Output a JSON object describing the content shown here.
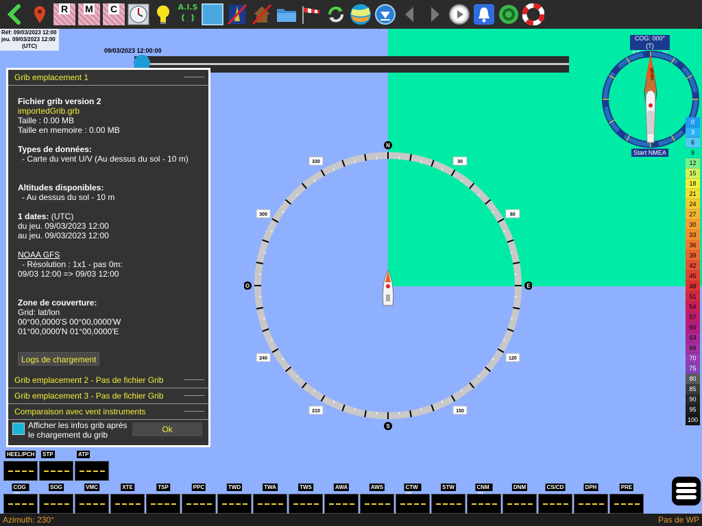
{
  "toolbar": {
    "items": [
      "back-arrow-icon",
      "map-pin-icon",
      "R",
      "M",
      "C",
      "clock-icon",
      "bulb-icon",
      "A.I.S",
      "square-icon",
      "boat-cross-icon",
      "home-cross-icon",
      "folder-icon",
      "windsock-icon",
      "refresh-icon",
      "grib-icon",
      "download-icon",
      "prev-icon",
      "next-icon",
      "play-icon",
      "bell-icon",
      "target-icon",
      "lifebuoy-icon"
    ],
    "ais_label": "A.I.S"
  },
  "ref": {
    "line1": "Réf: 09/03/2023 12:00",
    "line2": "jeu. 09/03/2023 12:00",
    "line3": "(UTC)"
  },
  "time_slider": {
    "label": "09/03/2023 12:00:00",
    "position": 0
  },
  "grib": {
    "section1": "Grib emplacement 1",
    "file_title": "Fichier grib version 2",
    "file_name": "importedGrib.grb",
    "size": "Taille : 0.00 MB",
    "memory": "Taille en memoire : 0.00 MB",
    "data_types_title": "Types de données:",
    "data_types_item": "- Carte du vent U/V (Au dessus du sol - 10 m)",
    "altitudes_title": "Altitudes disponibles:",
    "altitudes_item": "- Au dessus du sol - 10 m",
    "dates_title": "1 dates:",
    "dates_tz": " (UTC)",
    "dates_from": "du jeu. 09/03/2023 12:00",
    "dates_to": "au jeu. 09/03/2023 12:00",
    "model": "NOAA GFS",
    "resolution": "- Résolution : 1x1 - pas 0m:",
    "range": "09/03 12:00 => 09/03 12:00",
    "coverage_title": "Zone de couverture:",
    "grid": "Grid: lat/lon",
    "coord1": "00°00,0000'S 00°00,0000'W",
    "coord2": "01°00,0000'N 01°00,0000'E",
    "logs_button": "Logs de chargement",
    "section2": "Grib emplacement 2 - Pas de fichier Grib",
    "section3": "Grib emplacement 3 - Pas de fichier Grib",
    "section4": "Comparaison avec vent instruments",
    "checkbox_label": "Afficher les infos grib après le chargement du grib",
    "ok_button": "Ok"
  },
  "rose": {
    "n": "N",
    "e": "E",
    "s": "S",
    "w": "O",
    "deg30": "30",
    "deg60": "60",
    "deg120": "120",
    "deg150": "150",
    "deg210": "210",
    "deg240": "240",
    "deg300": "300",
    "deg330": "330"
  },
  "compass": {
    "cog": "COG: 000° (T)",
    "sog": "SOG: 0.0nds",
    "nmea": "Start NMEA",
    "boat_label": "qtVlm"
  },
  "wind_scale": [
    {
      "v": "0",
      "c": "#1e9cf0",
      "t": "#fff"
    },
    {
      "v": "3",
      "c": "#2bb1f5",
      "t": "#fff"
    },
    {
      "v": "6",
      "c": "#55c7f5",
      "t": "#000"
    },
    {
      "v": "9",
      "c": "#00eba5",
      "t": "#000"
    },
    {
      "v": "12",
      "c": "#7ef08a",
      "t": "#000"
    },
    {
      "v": "15",
      "c": "#d4f25a",
      "t": "#000"
    },
    {
      "v": "18",
      "c": "#f2ef3c",
      "t": "#000"
    },
    {
      "v": "21",
      "c": "#f5dc32",
      "t": "#000"
    },
    {
      "v": "24",
      "c": "#f5c832",
      "t": "#000"
    },
    {
      "v": "27",
      "c": "#f5b432",
      "t": "#000"
    },
    {
      "v": "30",
      "c": "#f5a032",
      "t": "#000"
    },
    {
      "v": "33",
      "c": "#f58c32",
      "t": "#000"
    },
    {
      "v": "36",
      "c": "#f07832",
      "t": "#000"
    },
    {
      "v": "39",
      "c": "#eb6432",
      "t": "#000"
    },
    {
      "v": "42",
      "c": "#e65032",
      "t": "#000"
    },
    {
      "v": "45",
      "c": "#e14032",
      "t": "#000"
    },
    {
      "v": "48",
      "c": "#dc3232",
      "t": "#000"
    },
    {
      "v": "51",
      "c": "#d22846",
      "t": "#000"
    },
    {
      "v": "54",
      "c": "#c81e5a",
      "t": "#000"
    },
    {
      "v": "57",
      "c": "#be1e6e",
      "t": "#000"
    },
    {
      "v": "60",
      "c": "#b41e82",
      "t": "#000"
    },
    {
      "v": "63",
      "c": "#aa2896",
      "t": "#000"
    },
    {
      "v": "66",
      "c": "#a032a0",
      "t": "#000"
    },
    {
      "v": "70",
      "c": "#963cb4",
      "t": "#fff"
    },
    {
      "v": "75",
      "c": "#8246b4",
      "t": "#fff"
    },
    {
      "v": "80",
      "c": "#5a5a5a",
      "t": "#fff"
    },
    {
      "v": "85",
      "c": "#3c3c3c",
      "t": "#fff"
    },
    {
      "v": "90",
      "c": "#282828",
      "t": "#fff"
    },
    {
      "v": "95",
      "c": "#1e1e1e",
      "t": "#fff"
    },
    {
      "v": "100",
      "c": "#141414",
      "t": "#fff"
    }
  ],
  "instruments_top": [
    "HEEL/PCH",
    "STP",
    "ATP"
  ],
  "instruments_bottom": [
    "COG (T)",
    "SOG",
    "VMC",
    "XTE",
    "TSP",
    "PPC",
    "TWD",
    "TWA",
    "TWS",
    "AWA",
    "AWS",
    "CTW (T)",
    "STW",
    "CNM (T)",
    "DNM",
    "CS/CD",
    "DPH",
    "PRE"
  ],
  "status": {
    "left": "Azimuth: 230°",
    "right": "Pas de WP"
  }
}
